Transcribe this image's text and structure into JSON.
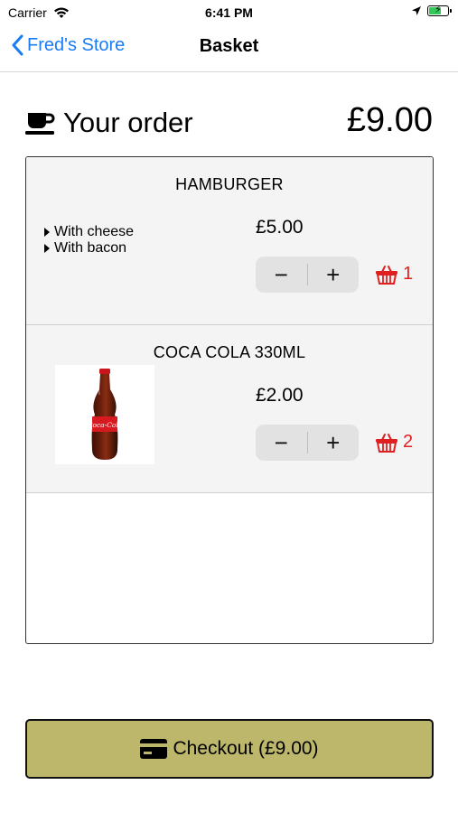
{
  "status_bar": {
    "carrier": "Carrier",
    "time": "6:41 PM",
    "icons": [
      "wifi-icon",
      "location-arrow-icon",
      "battery-charging-icon"
    ]
  },
  "nav": {
    "back_label": "Fred's Store",
    "title": "Basket"
  },
  "order": {
    "title": "Your order",
    "total": "£9.00",
    "icon": "coffee-cup-icon"
  },
  "items": [
    {
      "name": "HAMBURGER",
      "options": [
        "With cheese",
        "With bacon"
      ],
      "price": "£5.00",
      "minus": "−",
      "plus": "+",
      "count": "1"
    },
    {
      "name": "COCA COLA 330ML",
      "image": "coca-cola-bottle-image",
      "image_label": "Coca-Cola",
      "price": "£2.00",
      "minus": "−",
      "plus": "+",
      "count": "2"
    }
  ],
  "checkout": {
    "label": "Checkout (£9.00)",
    "icon": "credit-card-icon"
  },
  "colors": {
    "accent": "#1a7cf5",
    "remove": "#e02020",
    "checkout_bg": "#bdb76b",
    "item_bg": "#f4f4f4"
  }
}
